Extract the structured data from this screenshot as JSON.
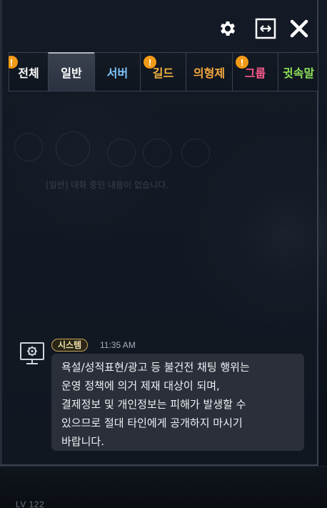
{
  "header": {
    "icons": [
      "gear-icon",
      "resize-icon",
      "close-icon"
    ]
  },
  "tabs": [
    {
      "label": "전체",
      "color": "#ffffff",
      "active": false,
      "alert": "!"
    },
    {
      "label": "일반",
      "color": "#ffffff",
      "active": true,
      "alert": ""
    },
    {
      "label": "서버",
      "color": "#7fc7ff",
      "active": false,
      "alert": ""
    },
    {
      "label": "길드",
      "color": "#f5b341",
      "active": false,
      "alert": "!"
    },
    {
      "label": "의형제",
      "color": "#f5a73f",
      "active": false,
      "alert": ""
    },
    {
      "label": "그룹",
      "color": "#ff5a8c",
      "active": false,
      "alert": "!"
    },
    {
      "label": "귓속말",
      "color": "#8de05a",
      "active": false,
      "alert": ""
    }
  ],
  "background": {
    "ghost_text": "[일반] 대화 중인 내용이 없습니다."
  },
  "message": {
    "badge": "시스템",
    "time": "11:35 AM",
    "text": "욕설/성적표현/광고 등 불건전 채팅 행위는\n운영 정책에 의거 제재 대상이 되며,\n결제정보 및 개인정보는 피해가 발생할 수\n있으므로 절대 타인에게 공개하지 마시기\n바랍니다.",
    "avatar_icon": "monitor-gear-icon"
  },
  "footer": {
    "level_text": "LV 122"
  },
  "colors": {
    "alert": "#f39a17",
    "badge_border": "#c9a75b",
    "bubble": "#2c323c"
  }
}
